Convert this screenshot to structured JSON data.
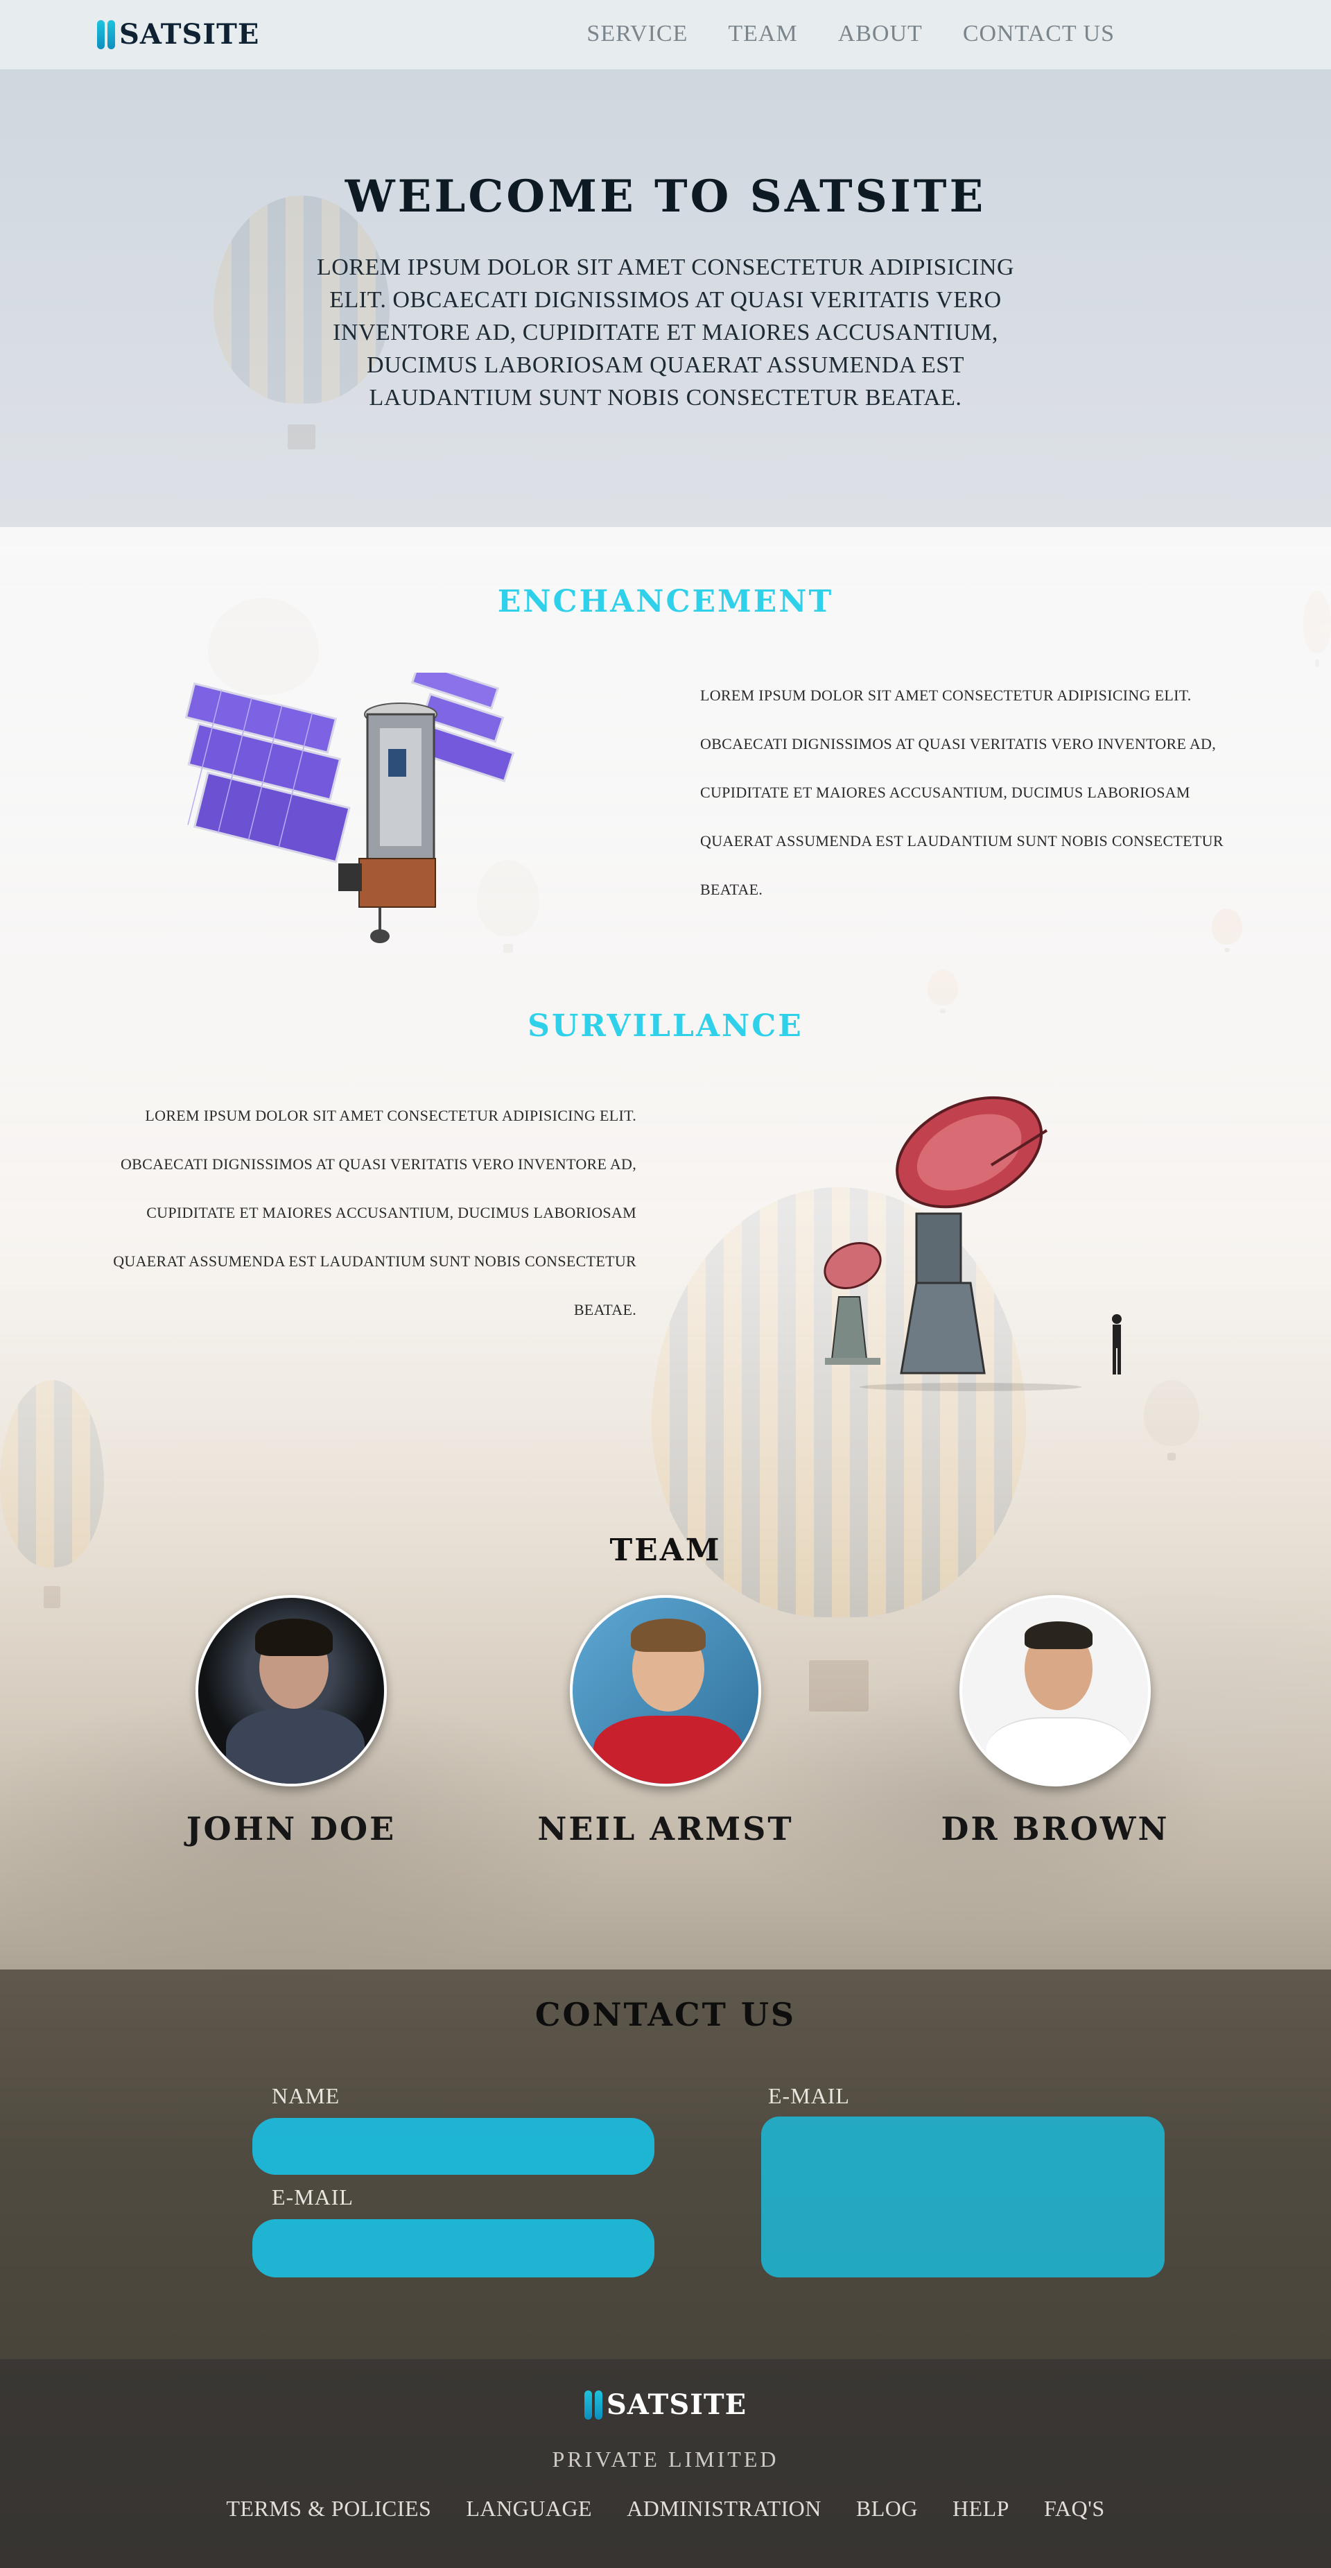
{
  "header": {
    "logo_text": "SATSITE",
    "nav": [
      "SERVICE",
      "TEAM",
      "ABOUT",
      "CONTACT US"
    ]
  },
  "hero": {
    "title": "WELCOME TO SATSITE",
    "text": "LOREM IPSUM DOLOR SIT AMET CONSECTETUR ADIPISICING ELIT. OBCAECATI DIGNISSIMOS AT QUASI VERITATIS VERO INVENTORE AD, CUPIDITATE ET MAIORES ACCUSANTIUM, DUCIMUS LABORIOSAM QUAERAT ASSUMENDA EST LAUDANTIUM SUNT NOBIS CONSECTETUR BEATAE."
  },
  "enhancement": {
    "title": "ENCHANCEMENT",
    "lines": [
      "LOREM IPSUM DOLOR SIT AMET CONSECTETUR ADIPISICING ELIT.",
      "OBCAECATI DIGNISSIMOS AT QUASI VERITATIS VERO INVENTORE AD,",
      "CUPIDITATE ET MAIORES ACCUSANTIUM, DUCIMUS LABORIOSAM",
      "QUAERAT ASSUMENDA EST LAUDANTIUM SUNT NOBIS CONSECTETUR",
      "BEATAE."
    ]
  },
  "surveillance": {
    "title": "SURVILLANCE",
    "lines": [
      "LOREM IPSUM DOLOR SIT AMET CONSECTETUR ADIPISICING ELIT.",
      "OBCAECATI DIGNISSIMOS AT QUASI VERITATIS VERO INVENTORE AD,",
      "CUPIDITATE ET MAIORES ACCUSANTIUM, DUCIMUS LABORIOSAM",
      "QUAERAT ASSUMENDA EST LAUDANTIUM SUNT NOBIS CONSECTETUR",
      "BEATAE."
    ]
  },
  "team": {
    "title": "TEAM",
    "members": [
      {
        "name": "JOHN DOE"
      },
      {
        "name": "NEIL ARMST"
      },
      {
        "name": "DR BROWN"
      }
    ]
  },
  "contact": {
    "title": "CONTACT US",
    "name_label": "NAME",
    "email_label": "E-MAIL",
    "email_label_2": "E-MAIL"
  },
  "footer": {
    "logo_text": "SATSITE",
    "subtitle": "PRIVATE LIMITED",
    "links": [
      "TERMS & POLICIES",
      "LANGUAGE",
      "ADMINISTRATION",
      "BLOG",
      "HELP",
      "FAQ'S"
    ]
  },
  "colors": {
    "accent": "#2fd1ea",
    "field": "#1bbee0"
  }
}
